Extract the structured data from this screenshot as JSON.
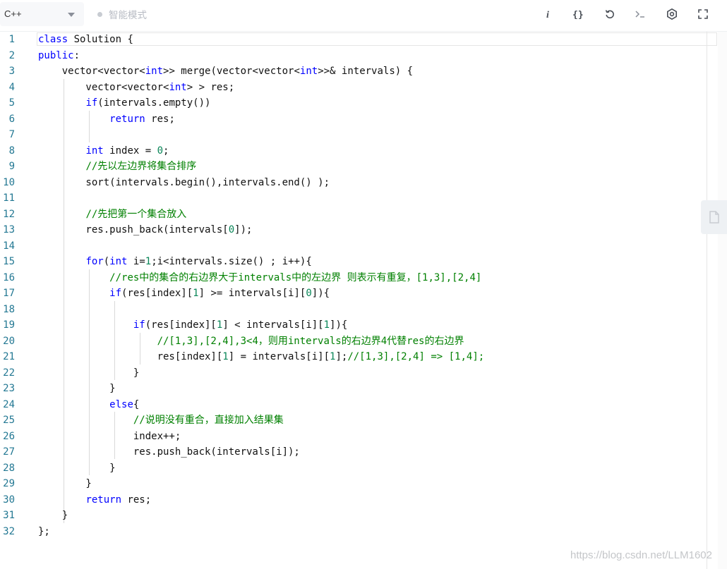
{
  "toolbar": {
    "language": "C++",
    "mode_label": "智能模式",
    "icons": [
      "info-icon",
      "format-braces-icon",
      "reset-icon",
      "console-icon",
      "settings-icon",
      "fullscreen-icon"
    ]
  },
  "editor": {
    "line_numbers": [
      "1",
      "2",
      "3",
      "4",
      "5",
      "6",
      "7",
      "8",
      "9",
      "10",
      "11",
      "12",
      "13",
      "14",
      "15",
      "16",
      "17",
      "18",
      "19",
      "20",
      "21",
      "22",
      "23",
      "24",
      "25",
      "26",
      "27",
      "28",
      "29",
      "30",
      "31",
      "32"
    ],
    "lines": [
      "class Solution {",
      "public:",
      "    vector<vector<int>> merge(vector<vector<int>>& intervals) {",
      "        vector<vector<int> > res;",
      "        if(intervals.empty())",
      "            return res;",
      "",
      "        int index = 0;",
      "        //先以左边界将集合排序",
      "        sort(intervals.begin(),intervals.end() );",
      "",
      "        //先把第一个集合放入",
      "        res.push_back(intervals[0]);",
      "",
      "        for(int i=1;i<intervals.size() ; i++){",
      "            //res中的集合的右边界大于intervals中的左边界 则表示有重复，[1,3],[2,4]",
      "            if(res[index][1] >= intervals[i][0]){",
      "",
      "                if(res[index][1] < intervals[i][1]){",
      "                    //[1,3],[2,4],3<4，则用intervals的右边界4代替res的右边界",
      "                    res[index][1] = intervals[i][1];//[1,3],[2,4] => [1,4];",
      "                }",
      "            }",
      "            else{",
      "                //说明没有重合，直接加入结果集",
      "                index++;",
      "                res.push_back(intervals[i]);",
      "            }",
      "        }",
      "        return res;",
      "    }",
      "};"
    ]
  },
  "watermark": "https://blog.csdn.net/LLM1602",
  "colors": {
    "keyword": "#0000ff",
    "number": "#098658",
    "comment": "#008000",
    "line_number": "#237893"
  }
}
